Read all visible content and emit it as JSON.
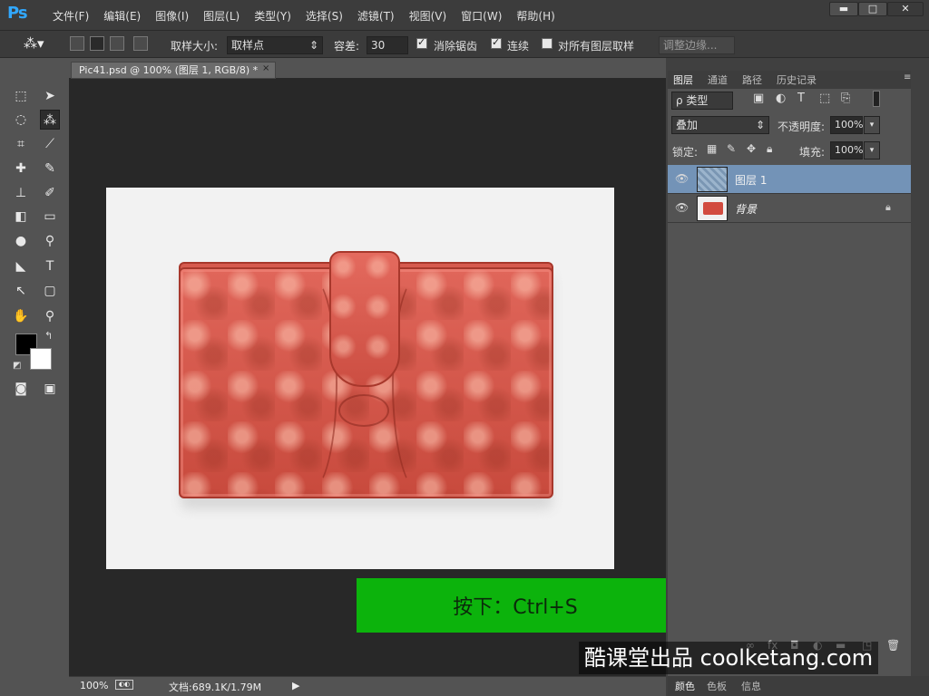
{
  "app": {
    "logo": "Ps"
  },
  "menu": [
    "文件(F)",
    "编辑(E)",
    "图像(I)",
    "图层(L)",
    "类型(Y)",
    "选择(S)",
    "滤镜(T)",
    "视图(V)",
    "窗口(W)",
    "帮助(H)"
  ],
  "window_controls": {
    "minimize": "▬",
    "maximize": "□",
    "close": "✕"
  },
  "options": {
    "sample_size_label": "取样大小:",
    "sample_size_value": "取样点",
    "tolerance_label": "容差:",
    "tolerance_value": "30",
    "antialias_label": "消除锯齿",
    "antialias_checked": true,
    "contiguous_label": "连续",
    "contiguous_checked": true,
    "sample_all_label": "对所有图层取样",
    "sample_all_checked": false,
    "refine_edge_label": "调整边缘..."
  },
  "document": {
    "tab_title": "Pic41.psd @ 100% (图层 1, RGB/8) *",
    "tab_close": "×",
    "zoom": "100%",
    "doc_size": "文档:689.1K/1.79M"
  },
  "hint": {
    "text": "按下：Ctrl+S",
    "color": "#0cb30c"
  },
  "watermark": {
    "text": "酷课堂出品 coolketang.com"
  },
  "panels": {
    "tabs": [
      "图层",
      "通道",
      "路径",
      "历史记录"
    ],
    "active_tab": "图层",
    "filter_label": "ρ 类型",
    "blend_mode": "叠加",
    "opacity_label": "不透明度:",
    "opacity_value": "100%",
    "lock_label": "锁定:",
    "fill_label": "填充:",
    "fill_value": "100%",
    "layers": [
      {
        "name": "图层 1",
        "selected": true,
        "visible": true
      },
      {
        "name": "背景",
        "selected": false,
        "visible": true,
        "locked": true
      }
    ],
    "bottom_tabs": [
      "颜色",
      "色板",
      "信息"
    ]
  },
  "colors": {
    "foreground": "#000000",
    "background": "#ffffff",
    "selection": "#7393b7"
  }
}
